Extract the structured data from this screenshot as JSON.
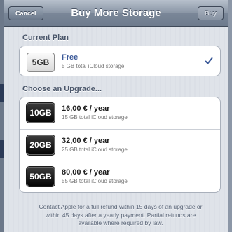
{
  "nav": {
    "title": "Buy More Storage",
    "cancel_label": "Cancel",
    "buy_label": "Buy"
  },
  "current": {
    "header": "Current Plan",
    "badge": "5GB",
    "title": "Free",
    "subtitle": "5 GB total iCloud storage",
    "icon": "checkmark-icon"
  },
  "upgrade": {
    "header": "Choose an Upgrade...",
    "options": [
      {
        "badge": "10GB",
        "price": "16,00 € / year",
        "subtitle": "15 GB total iCloud storage"
      },
      {
        "badge": "20GB",
        "price": "32,00 € / year",
        "subtitle": "25 GB total iCloud storage"
      },
      {
        "badge": "50GB",
        "price": "80,00 € / year",
        "subtitle": "55 GB total iCloud storage"
      }
    ]
  },
  "footer": {
    "line1": "Contact Apple for a full refund within 15 days of an upgrade or",
    "line2": "within 45 days after a yearly payment. Partial refunds are",
    "line3": "available where required by law."
  },
  "colors": {
    "accent": "#3b5998",
    "nav_bar": "#7a8798",
    "background": "#dde1e8"
  }
}
